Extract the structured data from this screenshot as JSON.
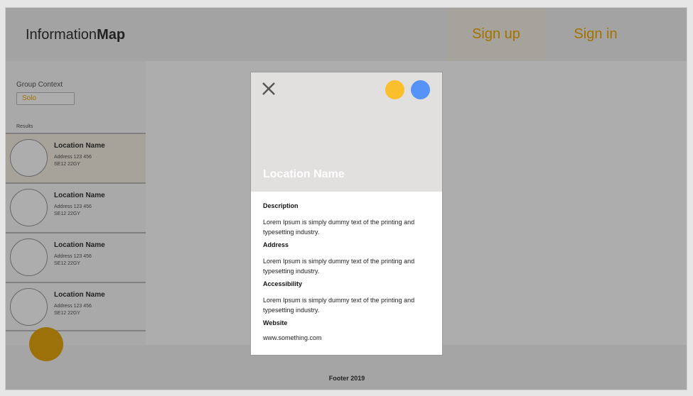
{
  "header": {
    "brand_light": "Information",
    "brand_bold": "Map",
    "signup_label": "Sign up",
    "signin_label": "Sign in"
  },
  "sidebar": {
    "group_label": "Group Context",
    "group_value": "Solo",
    "results_label": "Results",
    "results": [
      {
        "name": "Location Name",
        "address1": "Address 123 456",
        "address2": "SE12 22GY"
      },
      {
        "name": "Location Name",
        "address1": "Address 123 456",
        "address2": "SE12 22GY"
      },
      {
        "name": "Location Name",
        "address1": "Address 123 456",
        "address2": "SE12 22GY"
      },
      {
        "name": "Location Name",
        "address1": "Address 123 456",
        "address2": "SE12 22GY"
      }
    ]
  },
  "modal": {
    "title": "Location Name",
    "sections": {
      "description_head": "Description",
      "description_text": "Lorem Ipsum is simply dummy text of the printing and typesetting industry.",
      "address_head": "Address",
      "address_text": "Lorem Ipsum is simply dummy text of the printing and typesetting industry.",
      "accessibility_head": "Accessibility",
      "accessibility_text": "Lorem Ipsum is simply dummy text of the printing and typesetting industry.",
      "website_head": "Website",
      "website_link": "www.something.com"
    }
  },
  "footer": {
    "text": "Footer 2019"
  },
  "colors": {
    "accent": "#f0a800",
    "fab": "#e8a70f",
    "dot_yellow": "#fbbf2d",
    "dot_blue": "#5593f7"
  }
}
